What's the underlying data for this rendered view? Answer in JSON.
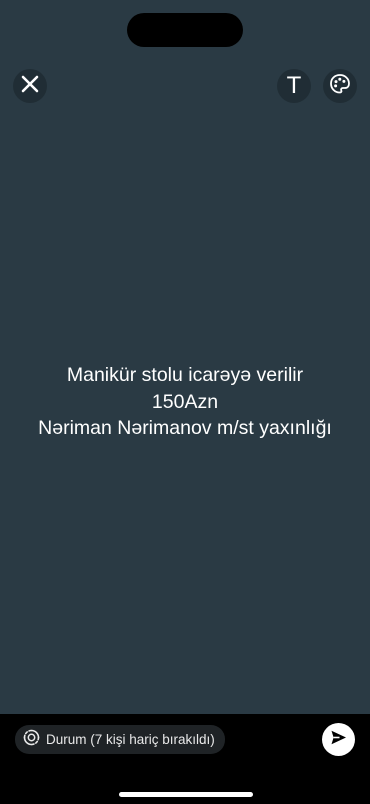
{
  "toolbar": {
    "close_icon": "close-icon",
    "text_tool_label": "T",
    "palette_icon": "palette-icon"
  },
  "status": {
    "lines": [
      "Manikür stolu icarəyə verilir",
      "150Azn",
      "Nəriman Nərimanov m/st yaxınlığı"
    ],
    "background_color": "#2a3a44",
    "text_color": "#ffffff"
  },
  "footer": {
    "audience_icon": "status-privacy-icon",
    "audience_label": "Durum (7 kişi hariç bırakıldı)",
    "send_icon": "send-icon"
  }
}
